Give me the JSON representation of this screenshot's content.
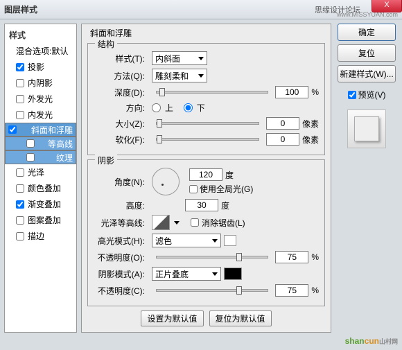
{
  "titlebar": {
    "title": "图层样式",
    "forum": "思缘设计论坛",
    "url": "www.MISSYUAN.com",
    "close": "X"
  },
  "left": {
    "header": "样式",
    "blend": "混合选项:默认",
    "items": [
      {
        "label": "投影",
        "checked": true
      },
      {
        "label": "内阴影",
        "checked": false
      },
      {
        "label": "外发光",
        "checked": false
      },
      {
        "label": "内发光",
        "checked": false
      },
      {
        "label": "斜面和浮雕",
        "checked": true,
        "selected": true
      },
      {
        "label": "等高线",
        "checked": false,
        "sub": true,
        "subsel": true
      },
      {
        "label": "纹理",
        "checked": false,
        "sub": true,
        "subsel": true
      },
      {
        "label": "光泽",
        "checked": false
      },
      {
        "label": "颜色叠加",
        "checked": false
      },
      {
        "label": "渐变叠加",
        "checked": true
      },
      {
        "label": "图案叠加",
        "checked": false
      },
      {
        "label": "描边",
        "checked": false
      }
    ]
  },
  "section1": {
    "title": "斜面和浮雕"
  },
  "struct": {
    "legend": "结构",
    "style_lbl": "样式(T):",
    "style_val": "内斜面",
    "method_lbl": "方法(Q):",
    "method_val": "雕刻柔和",
    "depth_lbl": "深度(D):",
    "depth_val": "100",
    "depth_unit": "%",
    "dir_lbl": "方向:",
    "up": "上",
    "down": "下",
    "size_lbl": "大小(Z):",
    "size_val": "0",
    "size_unit": "像素",
    "soft_lbl": "软化(F):",
    "soft_val": "0",
    "soft_unit": "像素"
  },
  "shadow": {
    "legend": "阴影",
    "angle_lbl": "角度(N):",
    "angle_val": "120",
    "angle_unit": "度",
    "global": "使用全局光(G)",
    "alt_lbl": "高度:",
    "alt_val": "30",
    "alt_unit": "度",
    "gloss_lbl": "光泽等高线:",
    "aa": "消除锯齿(L)",
    "hi_lbl": "高光模式(H):",
    "hi_val": "滤色",
    "hi_op_lbl": "不透明度(O):",
    "hi_op_val": "75",
    "hi_op_unit": "%",
    "sh_lbl": "阴影模式(A):",
    "sh_val": "正片叠底",
    "sh_op_lbl": "不透明度(C):",
    "sh_op_val": "75",
    "sh_op_unit": "%"
  },
  "bottom": {
    "set": "设置为默认值",
    "reset": "复位为默认值"
  },
  "right": {
    "ok": "确定",
    "cancel": "复位",
    "newstyle": "新建样式(W)...",
    "preview": "预览(V)"
  },
  "wm": {
    "a": "shan",
    "b": "cun",
    "c": "山村网"
  }
}
